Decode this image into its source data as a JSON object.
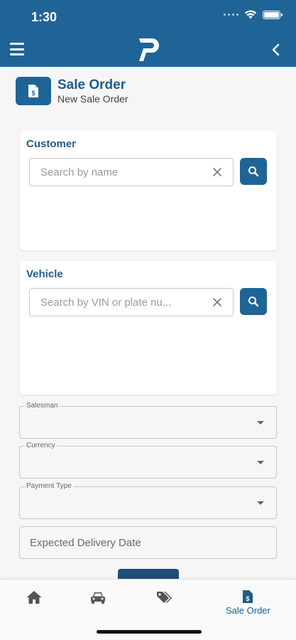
{
  "status": {
    "time": "1:30"
  },
  "header": {
    "menu_icon": "hamburger-icon",
    "logo_icon": "app-logo",
    "back_icon": "chevron-left-icon",
    "color": "#1f6496"
  },
  "page": {
    "icon": "invoice-dollar-icon",
    "title": "Sale Order",
    "subtitle": "New Sale Order"
  },
  "customer": {
    "title": "Customer",
    "placeholder": "Search by name",
    "value": ""
  },
  "vehicle": {
    "title": "Vehicle",
    "placeholder": "Search by VIN or plate nu...",
    "value": ""
  },
  "fields": {
    "salesman": {
      "label": "Salesman",
      "value": ""
    },
    "currency": {
      "label": "Currency",
      "value": ""
    },
    "payment_type": {
      "label": "Payment Type",
      "value": ""
    },
    "expected_delivery": {
      "label": "Expected Delivery Date"
    }
  },
  "tabs": [
    {
      "icon": "home-icon",
      "label": ""
    },
    {
      "icon": "car-icon",
      "label": ""
    },
    {
      "icon": "tags-icon",
      "label": ""
    },
    {
      "icon": "invoice-dollar-icon",
      "label": "Sale Order",
      "active": true
    }
  ]
}
